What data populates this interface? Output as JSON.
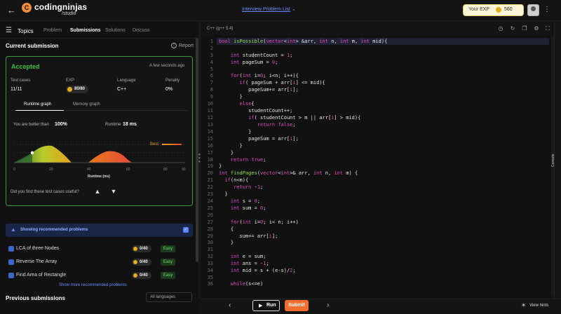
{
  "header": {
    "logo_mark": "C",
    "logo_text": "codingninjas",
    "logo_sub": "/studio",
    "problem_list": "Interview Problem List",
    "exp_label": "Your EXP",
    "exp_value": "560",
    "menu_dots": "⋮"
  },
  "left_tabs": {
    "topics": "Topics",
    "items": [
      "Problem",
      "Submissions",
      "Solutions",
      "Discuss"
    ],
    "active": "Submissions"
  },
  "submission": {
    "title": "Current submission",
    "report": "Report",
    "status": "Accepted",
    "time_ago": "A few seconds ago",
    "meta": [
      {
        "label": "Test cases",
        "value": "11/11"
      },
      {
        "label": "EXP",
        "value": "80/80"
      },
      {
        "label": "Language",
        "value": "C++"
      },
      {
        "label": "Penalty",
        "value": "0%"
      }
    ],
    "graph_tabs": [
      "Runtime graph",
      "Memory graph"
    ],
    "better_label": "You are better than",
    "better_value": "100%",
    "runtime_label": "Runtime",
    "runtime_value": "18 ms",
    "best_label": "Best",
    "x_ticks": [
      "0",
      "20",
      "40",
      "60",
      "80",
      "90"
    ],
    "x_axis_label": "Runtime (ms)",
    "useful_question": "Did you find these test cases useful?"
  },
  "recommended": {
    "label": "Showing recommended problems",
    "problems": [
      {
        "name": "LCA of three Nodes",
        "exp": "0/40",
        "difficulty": "Easy"
      },
      {
        "name": "Reverse The Array",
        "exp": "0/40",
        "difficulty": "Easy"
      },
      {
        "name": "Find Area of Rectangle",
        "exp": "0/40",
        "difficulty": "Easy"
      }
    ],
    "show_more": "Show more recommended problems"
  },
  "previous": {
    "title": "Previous submissions",
    "language_filter": "All languages"
  },
  "editor": {
    "language": "C++ (g++ 5.4)",
    "console": "Console",
    "line_numbers": [
      "1",
      "2",
      "3",
      "4",
      "5",
      "6",
      "7",
      "8",
      "9",
      "10",
      "11",
      "12",
      "13",
      "14",
      "15",
      "16",
      "17",
      "18",
      "19",
      "20",
      "21",
      "22",
      "23",
      "24",
      "25",
      "26",
      "27",
      "28",
      "29",
      "30",
      "31",
      "32",
      "33",
      "34",
      "35",
      "36"
    ]
  },
  "bottom": {
    "run": "Run",
    "submit": "Submit",
    "hints": "View hints"
  },
  "colors": {
    "accent": "#f36e2d",
    "accepted": "#3dc43d",
    "link": "#6b8cff"
  }
}
